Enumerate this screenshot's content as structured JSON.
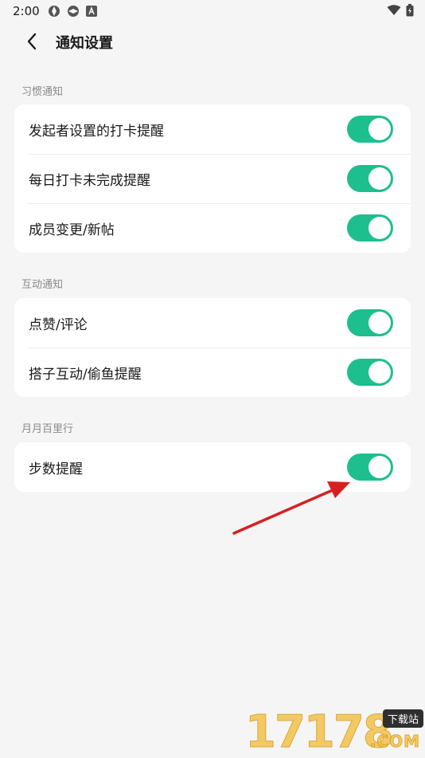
{
  "status_bar": {
    "time": "2:00",
    "left_icons": [
      "aperture-icon",
      "aperture-icon",
      "font-a-icon"
    ],
    "right_icons": [
      "wifi-icon",
      "battery-icon"
    ]
  },
  "header": {
    "title": "通知设置",
    "back_icon": "chevron-left-icon"
  },
  "sections": [
    {
      "label": "习惯通知",
      "items": [
        {
          "label": "发起者设置的打卡提醒",
          "enabled": true
        },
        {
          "label": "每日打卡未完成提醒",
          "enabled": true
        },
        {
          "label": "成员变更/新帖",
          "enabled": true
        }
      ]
    },
    {
      "label": "互动通知",
      "items": [
        {
          "label": "点赞/评论",
          "enabled": true
        },
        {
          "label": "搭子互动/偷鱼提醒",
          "enabled": true
        }
      ]
    },
    {
      "label": "月月百里行",
      "items": [
        {
          "label": "步数提醒",
          "enabled": true
        }
      ]
    }
  ],
  "colors": {
    "toggle_on": "#1dbf8f",
    "background": "#f5f5f5",
    "card": "#ffffff",
    "annotation_arrow": "#d62020"
  },
  "watermark": {
    "digits": "17178",
    "tag": "下载站",
    "suffix": ".COM"
  }
}
